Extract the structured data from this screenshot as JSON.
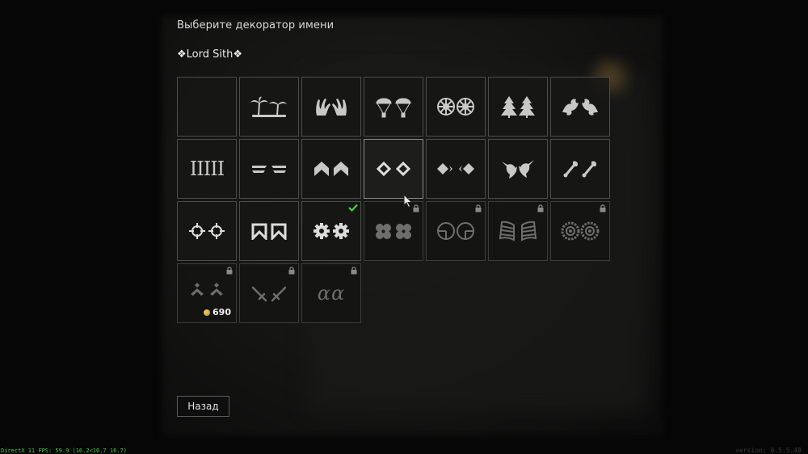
{
  "header": {
    "title": "Выберите декоратор имени",
    "preview_name": "❖Lord Sith❖"
  },
  "decorators": [
    {
      "icon": "empty",
      "state": "available"
    },
    {
      "icon": "palm-trees-icon",
      "state": "available"
    },
    {
      "icon": "claws-icon",
      "state": "available"
    },
    {
      "icon": "parachutes-icon",
      "state": "available"
    },
    {
      "icon": "wheels-icon",
      "state": "available"
    },
    {
      "icon": "fir-trees-icon",
      "state": "available"
    },
    {
      "icon": "dragons-icon",
      "state": "available"
    },
    {
      "icon": "bars-icon",
      "state": "available",
      "glyph": "IIIII"
    },
    {
      "icon": "wings-icon",
      "state": "available"
    },
    {
      "icon": "chevrons-icon",
      "state": "available"
    },
    {
      "icon": "diamonds-icon",
      "state": "available",
      "hover": true
    },
    {
      "icon": "arrow-diamonds-icon",
      "state": "available"
    },
    {
      "icon": "swordfish-icon",
      "state": "available"
    },
    {
      "icon": "wrenches-icon",
      "state": "available"
    },
    {
      "icon": "crosshairs-icon",
      "state": "available"
    },
    {
      "icon": "ribbons-icon",
      "state": "available"
    },
    {
      "icon": "gears-icon",
      "state": "selected"
    },
    {
      "icon": "clovers-icon",
      "state": "locked"
    },
    {
      "icon": "scopes-icon",
      "state": "locked"
    },
    {
      "icon": "tracks-icon",
      "state": "locked"
    },
    {
      "icon": "sprockets-icon",
      "state": "locked"
    },
    {
      "icon": "rank-chevrons-icon",
      "state": "locked",
      "price": "690"
    },
    {
      "icon": "crossed-swords-icon",
      "state": "locked"
    },
    {
      "icon": "alpha-icon",
      "state": "locked",
      "glyph": "αα"
    }
  ],
  "footer": {
    "back_label": "Назад",
    "fps_text": "DirectX 11 FPS: 59.9 (16.2<16.7 16.7)",
    "version_text": "version: 0.5.5.48"
  },
  "colors": {
    "icon_available": "#c8c8c8",
    "icon_locked": "#6e6e6c",
    "selected_check": "#4cd23c",
    "fps_text": "#3cd23c"
  }
}
